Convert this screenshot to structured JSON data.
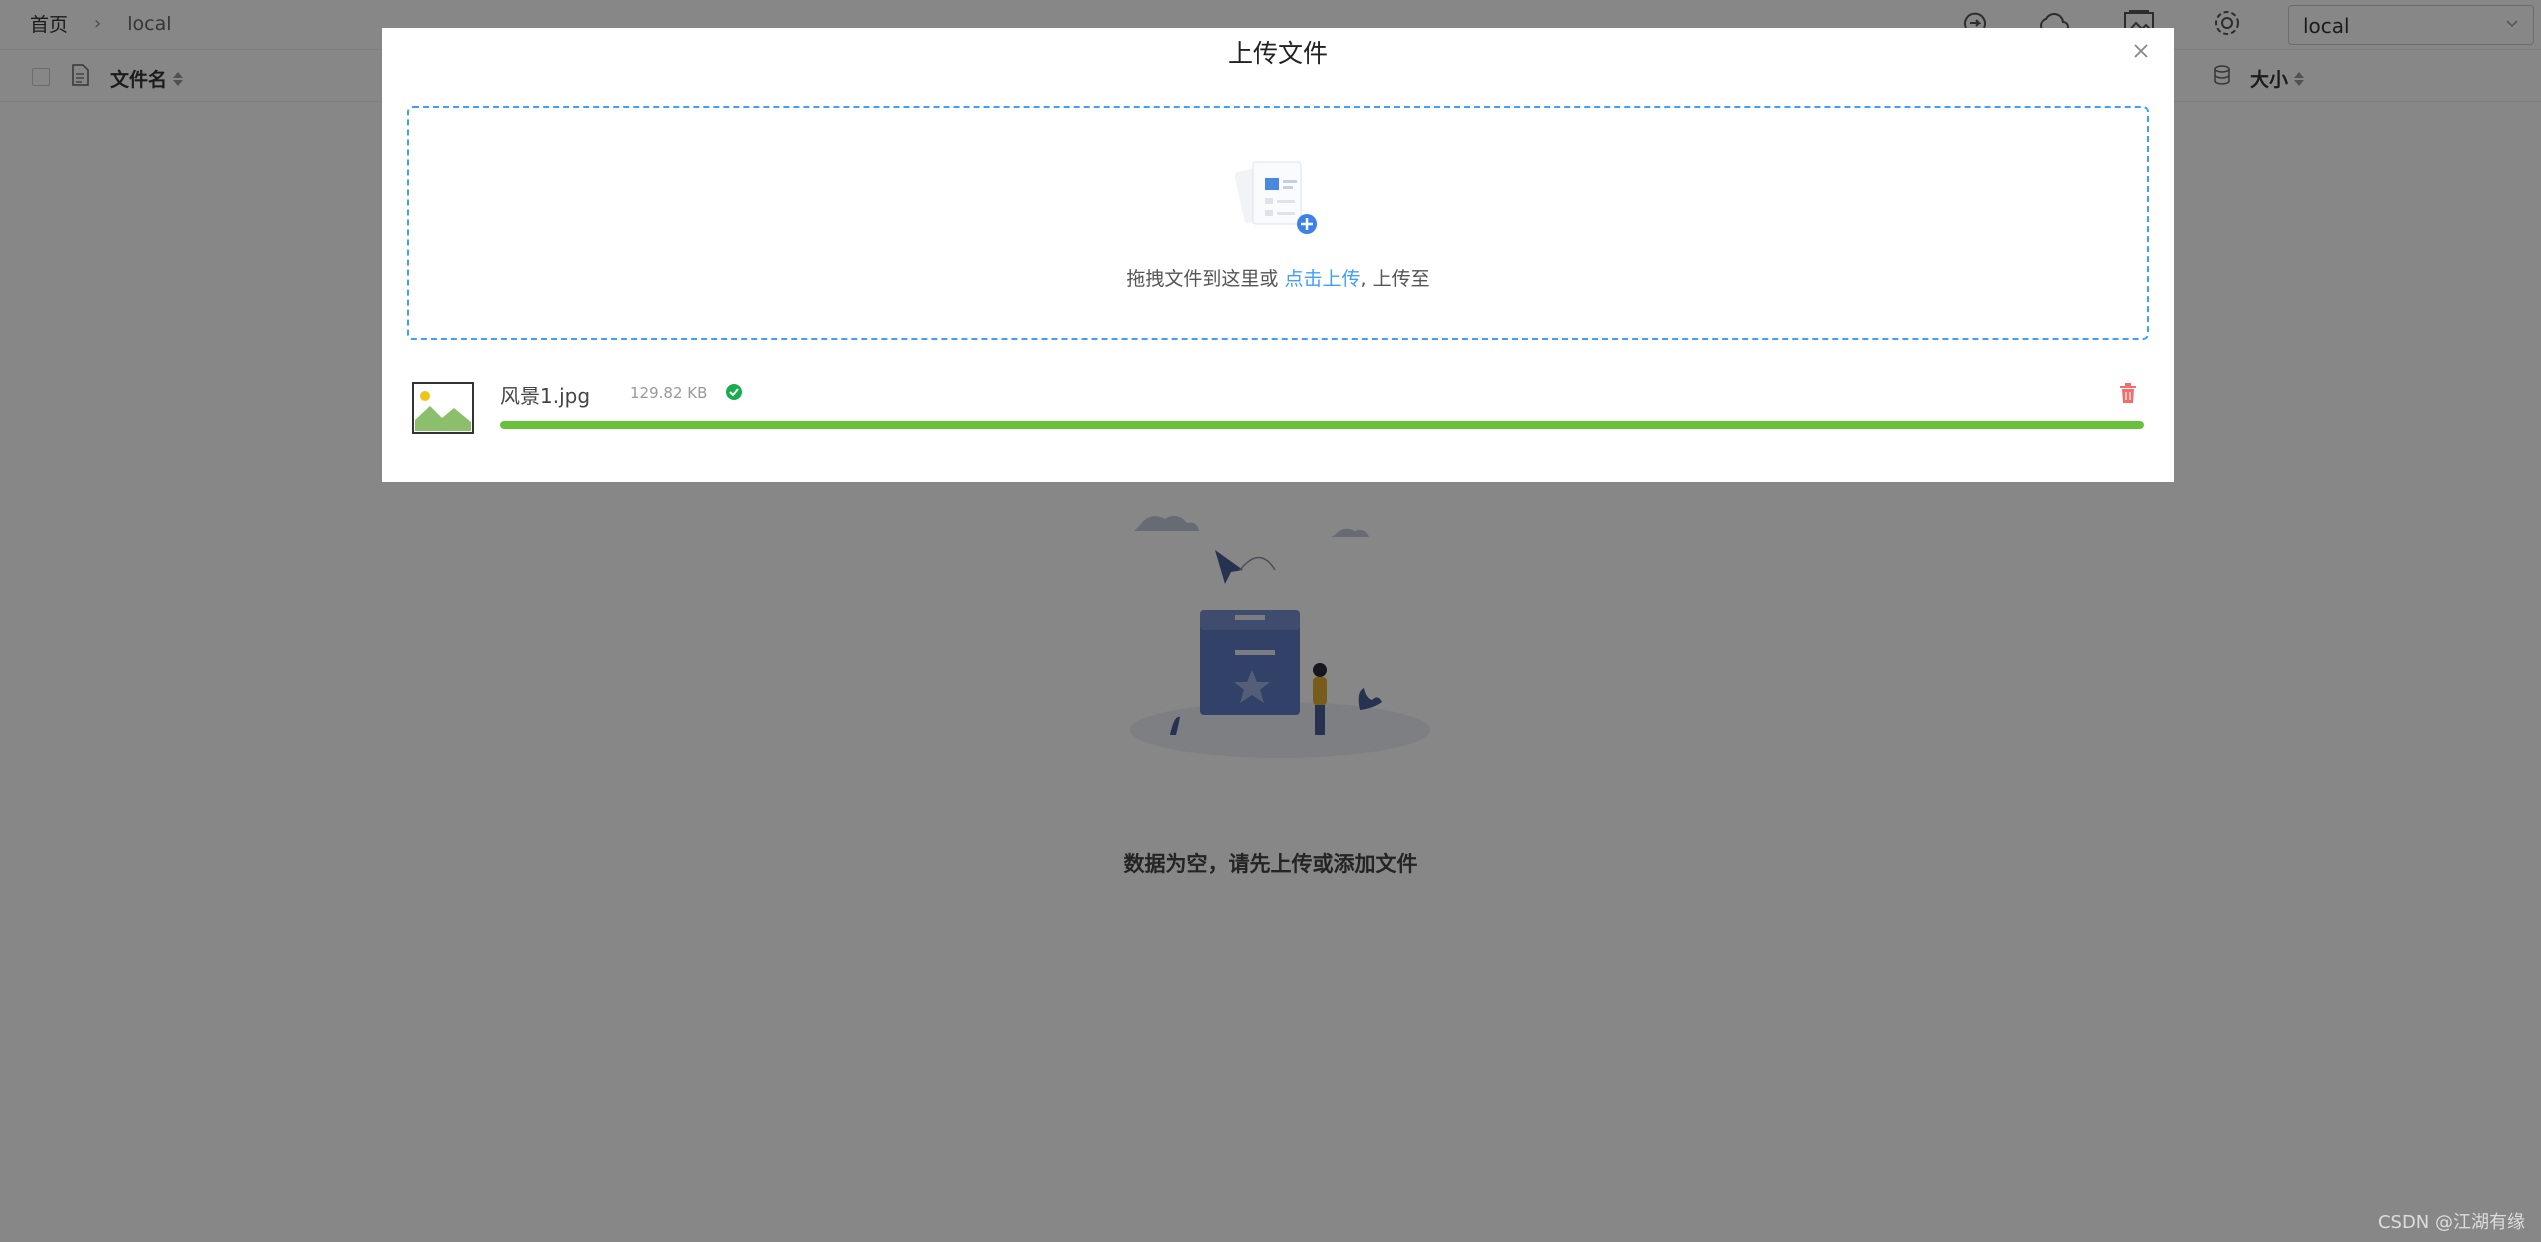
{
  "breadcrumb": {
    "home": "首页",
    "current": "local"
  },
  "toolbar": {
    "icons": [
      "sync-icon",
      "cloud-upload-icon",
      "gallery-icon",
      "gear-icon"
    ],
    "storage_select": "local"
  },
  "table": {
    "name_header": "文件名",
    "size_header": "大小"
  },
  "empty_state": {
    "text": "数据为空，请先上传或添加文件"
  },
  "upload_dialog": {
    "title": "上传文件",
    "drop_text": "拖拽文件到这里或 ",
    "drop_link": "点击上传",
    "drop_suffix": ", 上传至",
    "files": [
      {
        "name": "风景1.jpg",
        "size": "129.82 KB",
        "status": "success",
        "progress": 100
      }
    ]
  },
  "colors": {
    "accent": "#409eff",
    "success": "#67c23a",
    "success_icon": "#1aad4f",
    "danger": "#f56c6c"
  },
  "watermark": "CSDN @江湖有缘"
}
